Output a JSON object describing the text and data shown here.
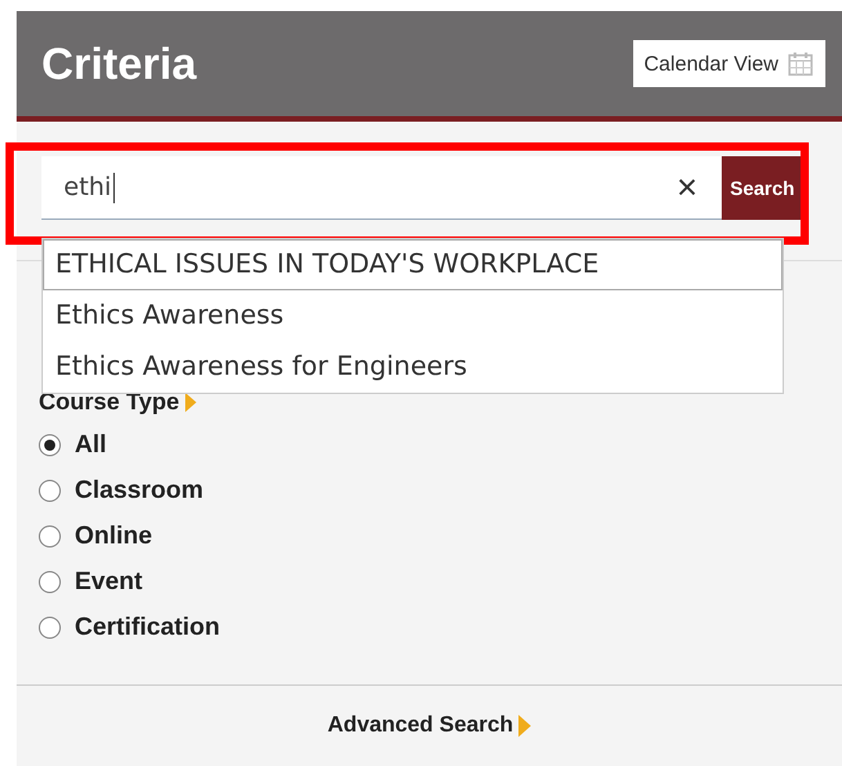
{
  "header": {
    "title": "Criteria",
    "calendar_button": "Calendar View"
  },
  "search": {
    "value": "ethi",
    "clear": "×",
    "button": "Search",
    "highlighted": true
  },
  "suggestions": [
    {
      "label": "ETHICAL ISSUES IN TODAY'S WORKPLACE",
      "selected": true
    },
    {
      "label": "Ethics Awareness",
      "selected": false
    },
    {
      "label": "Ethics Awareness for Engineers",
      "selected": false
    }
  ],
  "course_type": {
    "heading": "Course Type",
    "options": [
      {
        "label": "All",
        "selected": true
      },
      {
        "label": "Classroom",
        "selected": false
      },
      {
        "label": "Online",
        "selected": false
      },
      {
        "label": "Event",
        "selected": false
      },
      {
        "label": "Certification",
        "selected": false
      }
    ]
  },
  "advanced_search": "Advanced Search"
}
